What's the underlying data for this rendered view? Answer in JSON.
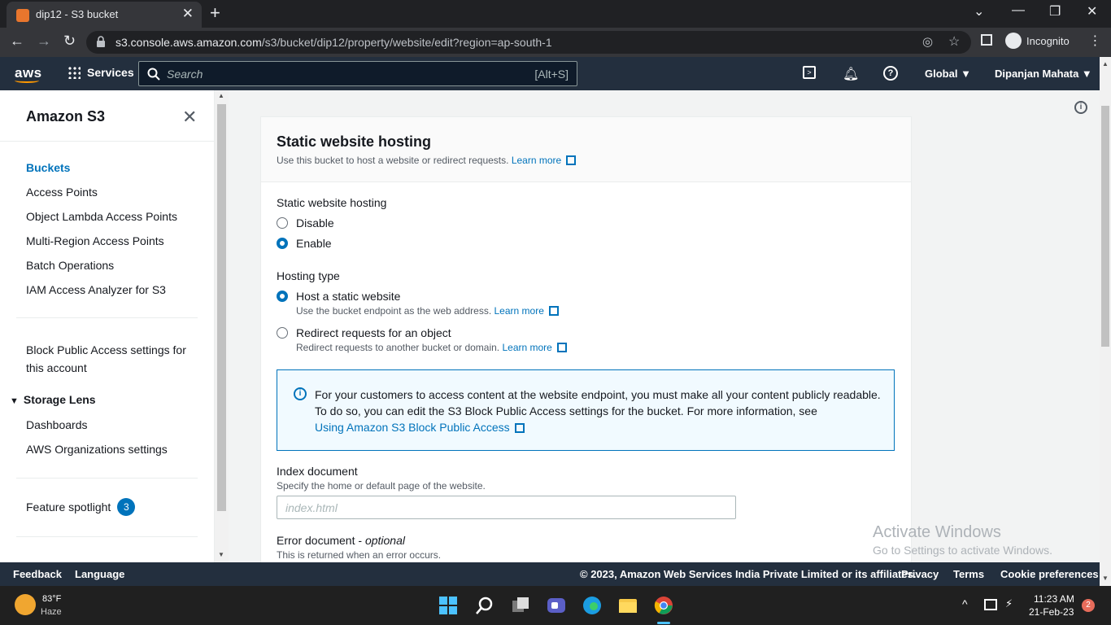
{
  "browser": {
    "tab_title": "dip12 - S3 bucket",
    "url_host": "s3.console.aws.amazon.com",
    "url_path": "/s3/bucket/dip12/property/website/edit?region=ap-south-1",
    "profile_label": "Incognito"
  },
  "aws_nav": {
    "logo": "aws",
    "services_label": "Services",
    "search_placeholder": "Search",
    "search_shortcut": "[Alt+S]",
    "region_label": "Global",
    "user_label": "Dipanjan Mahata"
  },
  "sidebar": {
    "title": "Amazon S3",
    "items": [
      {
        "label": "Buckets"
      },
      {
        "label": "Access Points"
      },
      {
        "label": "Object Lambda Access Points"
      },
      {
        "label": "Multi-Region Access Points"
      },
      {
        "label": "Batch Operations"
      },
      {
        "label": "IAM Access Analyzer for S3"
      }
    ],
    "block_public_line1": "Block Public Access settings for",
    "block_public_line2": "this account",
    "storage_lens_label": "Storage Lens",
    "storage_lens_items": [
      {
        "label": "Dashboards"
      },
      {
        "label": "AWS Organizations settings"
      }
    ],
    "feature_spotlight_label": "Feature spotlight",
    "feature_spotlight_count": "3"
  },
  "panel": {
    "title": "Static website hosting",
    "description": "Use this bucket to host a website or redirect requests.",
    "learn_more": "Learn more",
    "hosting_label": "Static website hosting",
    "disable_label": "Disable",
    "enable_label": "Enable",
    "hosting_type_label": "Hosting type",
    "host_static_label": "Host a static website",
    "host_static_hint": "Use the bucket endpoint as the web address.",
    "redirect_label": "Redirect requests for an object",
    "redirect_hint": "Redirect requests to another bucket or domain.",
    "info_text": "For your customers to access content at the website endpoint, you must make all your content publicly readable. To do so, you can edit the S3 Block Public Access settings for the bucket. For more information, see",
    "info_link": "Using Amazon S3 Block Public Access",
    "index_label": "Index document",
    "index_hint": "Specify the home or default page of the website.",
    "index_placeholder": "index.html",
    "error_label": "Error document - ",
    "error_optional": "optional",
    "error_hint": "This is returned when an error occurs."
  },
  "watermark": {
    "line1": "Activate Windows",
    "line2": "Go to Settings to activate Windows."
  },
  "footer": {
    "feedback": "Feedback",
    "language": "Language",
    "copyright": "© 2023, Amazon Web Services India Private Limited or its affiliates.",
    "privacy": "Privacy",
    "terms": "Terms",
    "cookie": "Cookie preferences"
  },
  "taskbar": {
    "temp": "83°F",
    "weather": "Haze",
    "time": "11:23 AM",
    "date": "21-Feb-23",
    "notification_count": "2"
  }
}
